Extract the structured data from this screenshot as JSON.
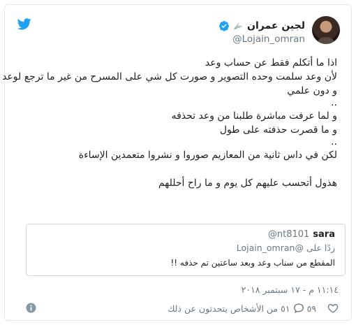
{
  "user": {
    "display_name": "لجين عمران",
    "handle": "@Lojain_omran"
  },
  "tweet": {
    "lines": [
      "اذا ما أتكلم فقط عن حساب وعد",
      "لأن وعد سلمت وحده التصوير و صورت كل شي على المسرح من غير ما ترجع لوعد",
      "و دون علمي",
      "..",
      "و لما عرفت مباشرة طلبنا من وعد تحذفه",
      "و ما قصرت حذفته على طول",
      "..",
      "لكن في داس ثانية من المعازيم صوروا و نشروا متعمدين الإساءة",
      "هذول أتحسب عليهم كل يوم و ما راح أحللهم"
    ]
  },
  "quoted": {
    "name": "sara",
    "handle": "@nt8101",
    "reply_prefix": "ردًا على",
    "reply_handle": "@Lojain_omran",
    "text": "المقطع من سناب وعد وبعد ساعتين تم حذفه !!"
  },
  "meta": {
    "timestamp": "١١:١٤ م - ١٧ سبتمبر ٢٠١٨"
  },
  "actions": {
    "likes": "٥٩",
    "replies": "٥١",
    "talking": "من الأشخاص يتحدثون عن ذلك"
  },
  "colors": {
    "twitter_blue": "#1da1f2",
    "text": "#1c2022",
    "secondary": "#697882",
    "border": "#e1e8ed"
  },
  "icons": {
    "brand": "twitter-bird-icon",
    "verified": "verified-badge-icon",
    "like": "heart-icon",
    "reply": "speech-bubble-icon",
    "info": "info-icon"
  }
}
